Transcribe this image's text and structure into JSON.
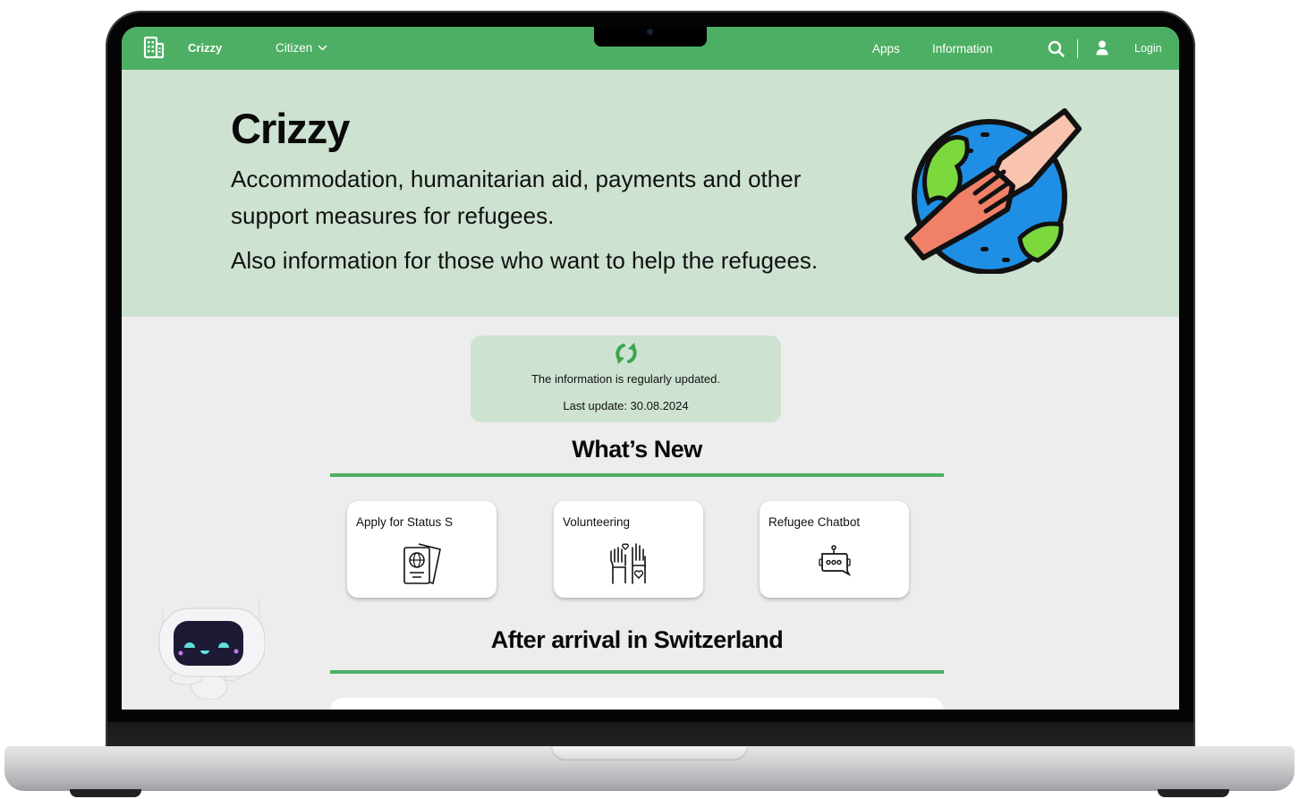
{
  "navbar": {
    "logo_icon": "building-icon",
    "brand": "Crizzy",
    "citizen_menu": "Citizen",
    "apps": "Apps",
    "information": "Information",
    "search_icon": "search-icon",
    "user_icon": "user-icon",
    "login": "Login"
  },
  "hero": {
    "title": "Crizzy",
    "description": "Accommodation, humanitarian aid, payments and other support measures for refugees.",
    "description2": "Also information for those who want to help the refugees.",
    "illustration": "globe-helping-hands-illustration"
  },
  "update_notice": {
    "icon": "refresh-icon",
    "text": "The information is regularly updated.",
    "last_update": "Last update: 30.08.2024"
  },
  "whats_new": {
    "title": "What’s New",
    "cards": [
      {
        "title": "Apply for Status S",
        "icon": "passport-icon"
      },
      {
        "title": "Volunteering",
        "icon": "raised-hands-heart-icon"
      },
      {
        "title": "Refugee Chatbot",
        "icon": "chatbot-icon"
      }
    ]
  },
  "after_arrival": {
    "title": "After arrival in Switzerland"
  },
  "mascot": "robot-mascot",
  "colors": {
    "primary_green": "#4caf63",
    "light_green": "#cde2d1",
    "page_bg": "#ededed"
  }
}
